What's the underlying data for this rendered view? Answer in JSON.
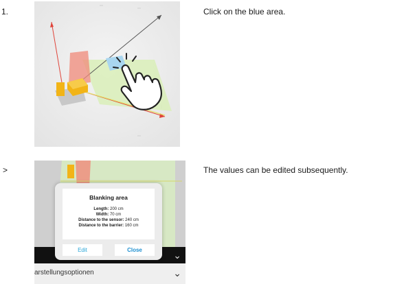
{
  "steps": [
    {
      "marker": "1.",
      "text": "Click on the blue area."
    },
    {
      "marker": ">",
      "text": "The values can be edited subsequently."
    }
  ],
  "dialog": {
    "title": "Blanking area",
    "lines": [
      {
        "label": "Length:",
        "value": " 200 cm"
      },
      {
        "label": "Width:",
        "value": " 70 cm"
      },
      {
        "label": "Distance to the sensor:",
        "value": " 240 cm"
      },
      {
        "label": "Distance to the barrier:",
        "value": " 160 cm"
      }
    ],
    "edit_label": "Edit",
    "close_label": "Close"
  },
  "bottom_bar": {
    "label": "arstellungsoptionen"
  },
  "icons": {
    "hand": "pointing-hand-icon",
    "chevron": "chevron-down-icon"
  },
  "colors": {
    "blue_area": "#a9d6ef",
    "red_area": "#f08a7a",
    "green_area": "#cfe9a8",
    "sensor_yellow": "#f2b417",
    "accent_blue": "#2aa6d8"
  }
}
